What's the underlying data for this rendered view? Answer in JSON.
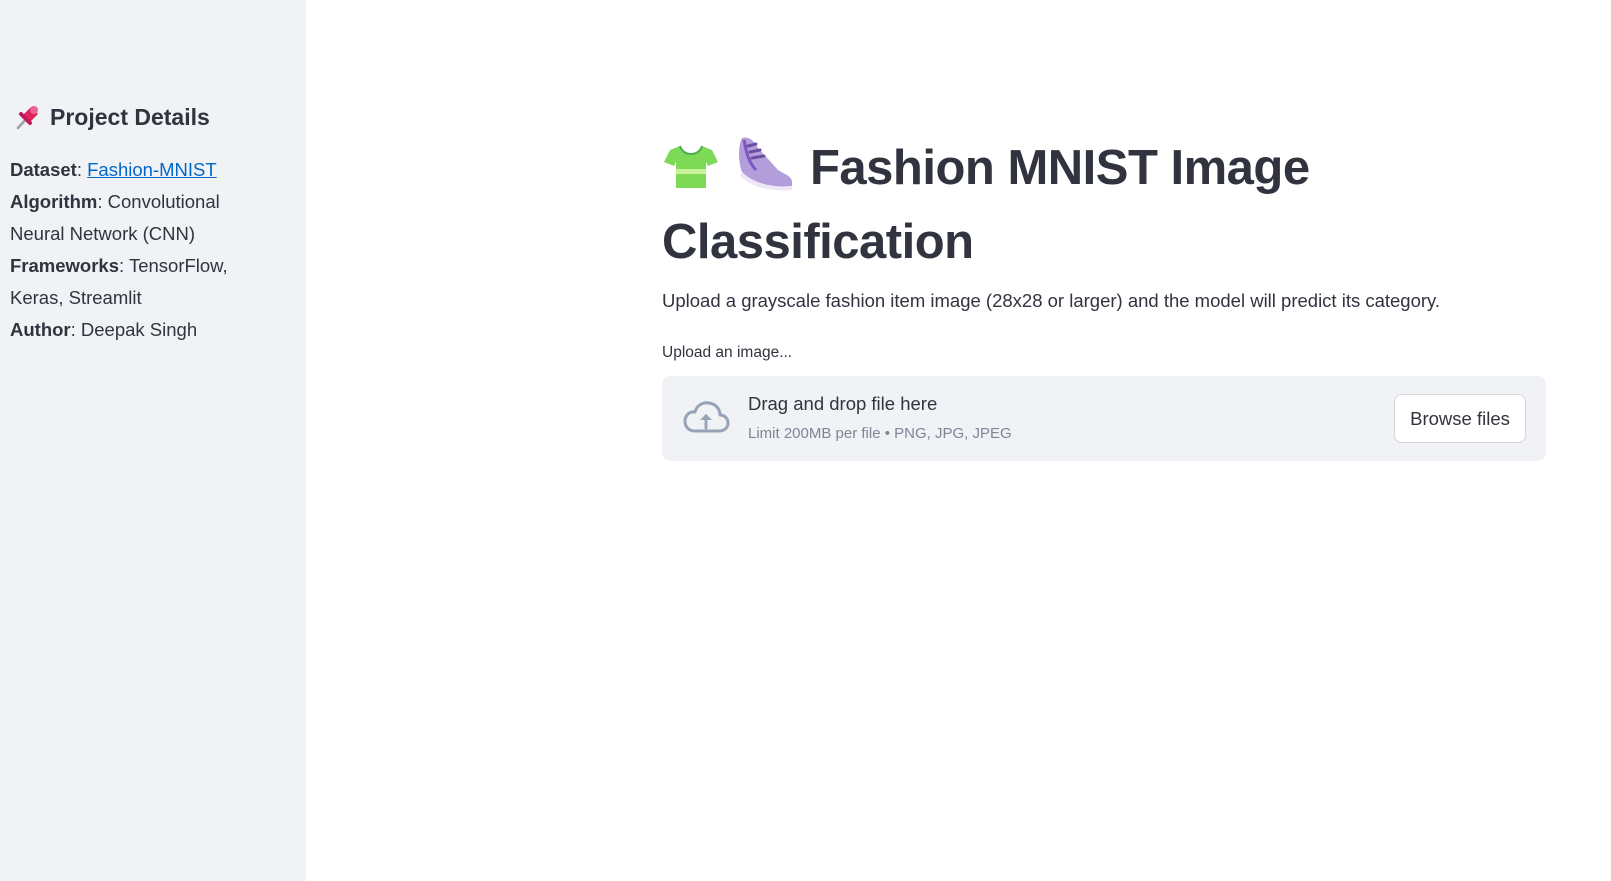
{
  "sidebar": {
    "heading": "Project Details",
    "heading_icon": "pushpin-icon",
    "details": [
      {
        "key": "Dataset",
        "sep": ": ",
        "value": "Fashion-MNIST",
        "is_link": true
      },
      {
        "key": "Algorithm",
        "sep": ": ",
        "value": "Convolutional Neural Network (CNN)",
        "is_link": false
      },
      {
        "key": "Frameworks",
        "sep": ": ",
        "value": "TensorFlow, Keras, Streamlit",
        "is_link": false
      },
      {
        "key": "Author",
        "sep": ": ",
        "value": "Deepak Singh",
        "is_link": false
      }
    ]
  },
  "main": {
    "title": "Fashion MNIST Image Classification",
    "title_icons": [
      "tshirt-icon",
      "sneaker-icon"
    ],
    "subtitle": "Upload a grayscale fashion item image (28x28 or larger) and the model will predict its category.",
    "uploader": {
      "label": "Upload an image...",
      "drop_title": "Drag and drop file here",
      "limit_text": "Limit 200MB per file • PNG, JPG, JPEG",
      "browse_label": "Browse files"
    }
  },
  "colors": {
    "sidebar_bg": "#f0f2f6",
    "text": "#31333f",
    "link": "#0068c9",
    "muted": "#808495"
  }
}
